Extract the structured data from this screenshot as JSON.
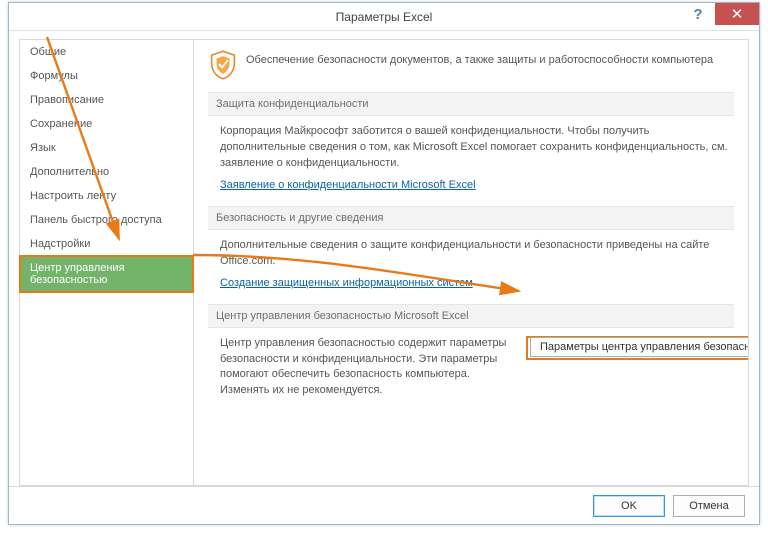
{
  "window": {
    "title": "Параметры Excel"
  },
  "winButtons": {
    "help": "?",
    "close": "✕"
  },
  "sidebar": {
    "items": [
      {
        "label": "Общие"
      },
      {
        "label": "Формулы"
      },
      {
        "label": "Правописание"
      },
      {
        "label": "Сохранение"
      },
      {
        "label": "Язык"
      },
      {
        "label": "Дополнительно"
      },
      {
        "label": "Настроить ленту"
      },
      {
        "label": "Панель быстрого доступа"
      },
      {
        "label": "Надстройки"
      },
      {
        "label": "Центр управления безопасностью"
      }
    ],
    "selectedIndex": 9
  },
  "banner": {
    "text": "Обеспечение безопасности документов, а также защиты и работоспособности компьютера"
  },
  "sections": {
    "privacy": {
      "title": "Защита конфиденциальности",
      "body": "Корпорация Майкрософт заботится о вашей конфиденциальности. Чтобы получить дополнительные сведения о том, как Microsoft Excel помогает сохранить конфиденциальность, см. заявление о конфиденциальности.",
      "link": "Заявление о конфиденциальности Microsoft Excel"
    },
    "security": {
      "title": "Безопасность и другие сведения",
      "body": "Дополнительные сведения о защите конфиденциальности и безопасности приведены на сайте Office.com.",
      "link": "Создание защищенных информационных систем"
    },
    "trustCenter": {
      "title": "Центр управления безопасностью Microsoft Excel",
      "body": "Центр управления безопасностью содержит параметры безопасности и конфиденциальности. Эти параметры помогают обеспечить безопасность компьютера. Изменять их не рекомендуется.",
      "button": "Параметры центра управления безопасностью..."
    }
  },
  "footer": {
    "ok": "OK",
    "cancel": "Отмена"
  }
}
